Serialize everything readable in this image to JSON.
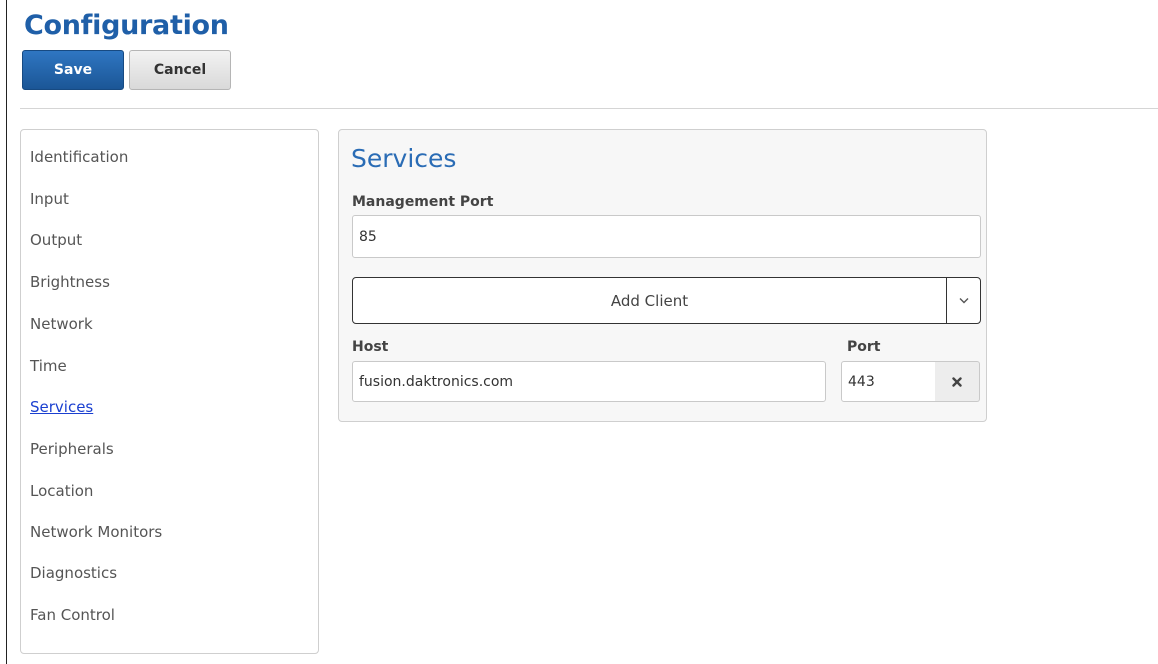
{
  "header": {
    "title": "Configuration",
    "save_label": "Save",
    "cancel_label": "Cancel"
  },
  "sidebar": {
    "items": [
      {
        "label": "Identification"
      },
      {
        "label": "Input"
      },
      {
        "label": "Output"
      },
      {
        "label": "Brightness"
      },
      {
        "label": "Network"
      },
      {
        "label": "Time"
      },
      {
        "label": "Services",
        "active": true
      },
      {
        "label": "Peripherals"
      },
      {
        "label": "Location"
      },
      {
        "label": "Network Monitors"
      },
      {
        "label": "Diagnostics"
      },
      {
        "label": "Fan Control"
      }
    ]
  },
  "services": {
    "title": "Services",
    "management_port_label": "Management Port",
    "management_port_value": "85",
    "add_client_label": "Add Client",
    "host_label": "Host",
    "host_value": "fusion.daktronics.com",
    "port_label": "Port",
    "port_value": "443"
  },
  "icons": {
    "dropdown": "chevron-down-icon",
    "remove": "close-icon"
  },
  "colors": {
    "title": "#1f5fa8",
    "save_button": "#1b5696",
    "active_link": "#1a3fd0",
    "panel_title": "#2a6cb5"
  }
}
